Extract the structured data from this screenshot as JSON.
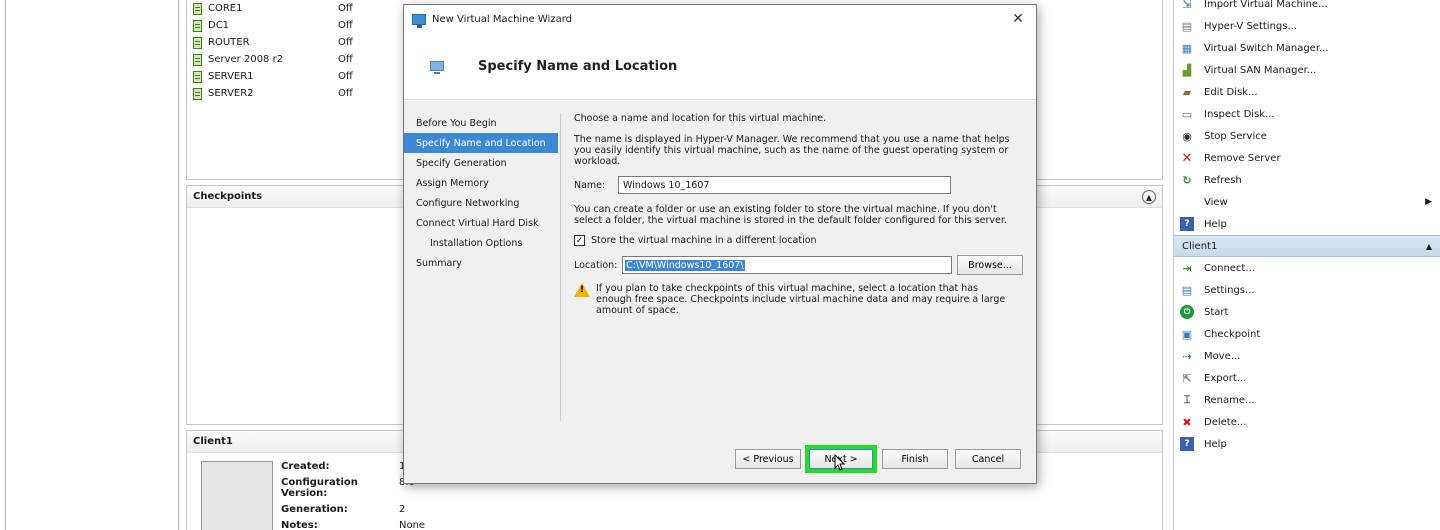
{
  "vm_list": [
    {
      "name": "CORE1",
      "state": "Off"
    },
    {
      "name": "DC1",
      "state": "Off"
    },
    {
      "name": "ROUTER",
      "state": "Off"
    },
    {
      "name": "Server 2008 r2",
      "state": "Off"
    },
    {
      "name": "SERVER1",
      "state": "Off"
    },
    {
      "name": "SERVER2",
      "state": "Off"
    }
  ],
  "checkpoints_pane": {
    "title": "Checkpoints"
  },
  "details_pane": {
    "title": "Client1",
    "fields": [
      {
        "label": "Created:",
        "value": "1"
      },
      {
        "label": "Configuration Version:",
        "value": "8.0"
      },
      {
        "label": "Generation:",
        "value": "2"
      },
      {
        "label": "Notes:",
        "value": "None"
      }
    ]
  },
  "actions": {
    "server_items": [
      {
        "label": "Import Virtual Machine...",
        "icon": "import-icon"
      },
      {
        "label": "Hyper-V Settings...",
        "icon": "settings-icon"
      },
      {
        "label": "Virtual Switch Manager...",
        "icon": "switch-icon"
      },
      {
        "label": "Virtual SAN Manager...",
        "icon": "san-icon"
      },
      {
        "label": "Edit Disk...",
        "icon": "edit-disk-icon"
      },
      {
        "label": "Inspect Disk...",
        "icon": "inspect-disk-icon"
      },
      {
        "label": "Stop Service",
        "icon": "stop-icon"
      },
      {
        "label": "Remove Server",
        "icon": "remove-icon"
      },
      {
        "label": "Refresh",
        "icon": "refresh-icon"
      },
      {
        "label": "View",
        "icon": ""
      },
      {
        "label": "Help",
        "icon": "help-icon"
      }
    ],
    "vm_section_title": "Client1",
    "vm_items": [
      {
        "label": "Connect...",
        "icon": "connect-icon"
      },
      {
        "label": "Settings...",
        "icon": "settings-icon"
      },
      {
        "label": "Start",
        "icon": "start-icon"
      },
      {
        "label": "Checkpoint",
        "icon": "checkpoint-icon"
      },
      {
        "label": "Move...",
        "icon": "move-icon"
      },
      {
        "label": "Export...",
        "icon": "export-icon"
      },
      {
        "label": "Rename...",
        "icon": "rename-icon"
      },
      {
        "label": "Delete...",
        "icon": "delete-icon"
      },
      {
        "label": "Help",
        "icon": "help-icon"
      }
    ]
  },
  "dialog": {
    "title": "New Virtual Machine Wizard",
    "header_title": "Specify Name and Location",
    "steps": [
      {
        "label": "Before You Begin",
        "active": false,
        "indent": false
      },
      {
        "label": "Specify Name and Location",
        "active": true,
        "indent": false
      },
      {
        "label": "Specify Generation",
        "active": false,
        "indent": false
      },
      {
        "label": "Assign Memory",
        "active": false,
        "indent": false
      },
      {
        "label": "Configure Networking",
        "active": false,
        "indent": false
      },
      {
        "label": "Connect Virtual Hard Disk",
        "active": false,
        "indent": false
      },
      {
        "label": "Installation Options",
        "active": false,
        "indent": true
      },
      {
        "label": "Summary",
        "active": false,
        "indent": false
      }
    ],
    "intro": "Choose a name and location for this virtual machine.",
    "name_help": "The name is displayed in Hyper-V Manager. We recommend that you use a name that helps you easily identify this virtual machine, such as the name of the guest operating system or workload.",
    "name_label": "Name:",
    "name_value": "Windows 10_1607",
    "folder_help": "You can create a folder or use an existing folder to store the virtual machine. If you don't select a folder, the virtual machine is stored in the default folder configured for this server.",
    "store_checkbox_label": "Store the virtual machine in a different location",
    "store_checked": true,
    "location_label": "Location:",
    "location_value": "C:\\VM\\Windows10_1607\\",
    "browse_label": "Browse...",
    "warning": "If you plan to take checkpoints of this virtual machine, select a location that has enough free space. Checkpoints include virtual machine data and may require a large amount of space.",
    "buttons": {
      "previous": "< Previous",
      "next": "Next >",
      "finish": "Finish",
      "cancel": "Cancel"
    },
    "highlight_color": "#22dd22"
  }
}
